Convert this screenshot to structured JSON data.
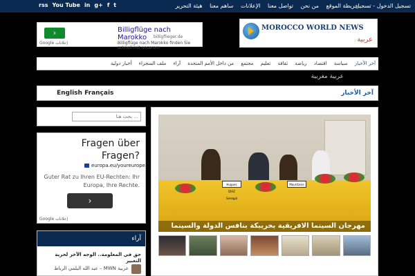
{
  "topbar": {
    "login": "تسجيل الدخول - تسجيل",
    "links": [
      "خريطة الموقع",
      "من نحن",
      "تواصل معنا",
      "الإعلانات",
      "ساهم معنا",
      "هيئة التحرير"
    ],
    "socials": [
      "rss",
      "You Tube",
      "in",
      "g+",
      "f",
      "t"
    ]
  },
  "header": {
    "ad": {
      "title": "Billigflüge nach Marokko",
      "url": "billigflieger.de",
      "desc": "Billigflüge nach Marokko finden Sie schnell mit unserem",
      "label": "Google إعلانات"
    },
    "logo": {
      "title": "MOROCCO WORLD NEWS",
      "sub": "عربية"
    }
  },
  "nav": {
    "items": [
      "آخر الأخبار",
      "سياسة",
      "اقتصاد",
      "رياضة",
      "ثقافة",
      "تعليم",
      "مجتمع",
      "من داخل الأمم المتحدة",
      "آراء",
      "ملف السجراء",
      "أخبار دولية"
    ]
  },
  "strip": {
    "text": "عربية مغربية"
  },
  "section": {
    "lang": "English Français",
    "label": "آخر الأخبار"
  },
  "search": {
    "placeholder": "بحث هنا ..."
  },
  "ad2": {
    "headline": "Fragen über Fragen?",
    "source": "europa.eu/youreurope",
    "body": "Guter Rat zu Ihren EU-Rechten: Ihr Europa, Ihre Rechte.",
    "button": "›",
    "label": "Google إعلانات"
  },
  "opinions": {
    "heading": "آراء",
    "title": "حق في المعلومة.. الوجه الآخر لحرية التعبير",
    "desc": "عبد الله البلمي الرباط – MWN عربية"
  },
  "slider": {
    "caption": "مهرجان السينما الافريقية بخريبكة بنافس الدولة والسينما",
    "nameplates": [
      "Hugues DIAZ Senegal",
      "Mauritanie",
      ""
    ]
  },
  "colors": {
    "brand": "#0b2a52",
    "accent": "#1d5aa0"
  }
}
